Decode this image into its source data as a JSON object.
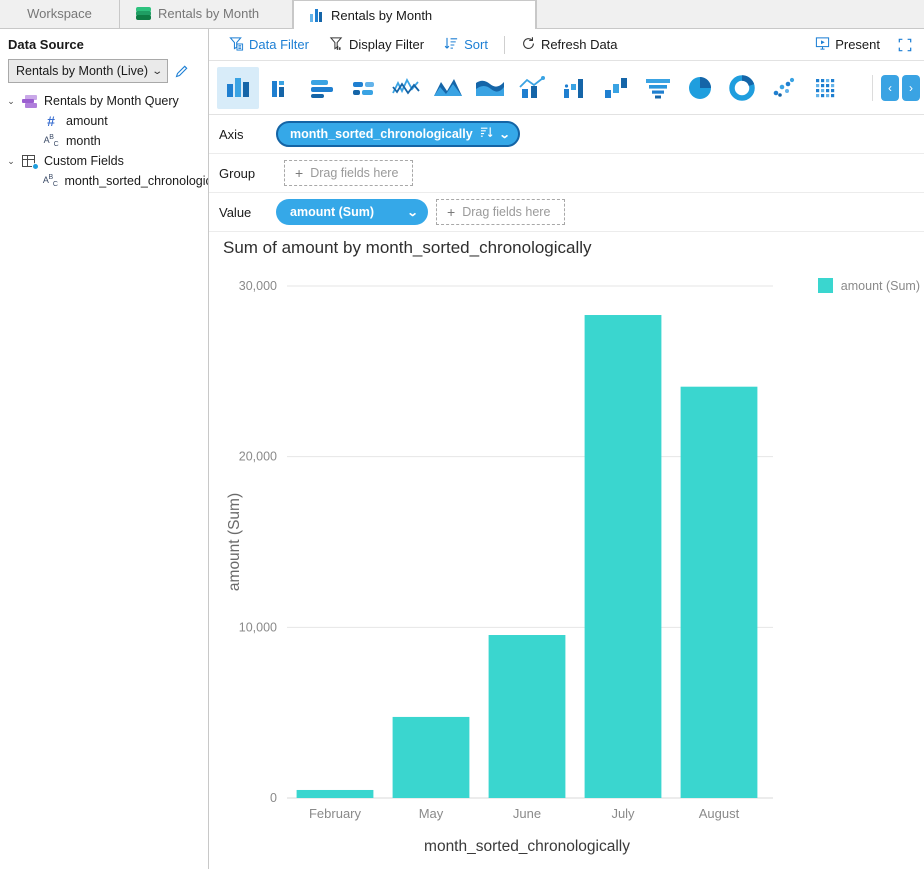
{
  "window": {
    "tabs": [
      {
        "label": "Workspace",
        "icon": "none",
        "active": false
      },
      {
        "label": "Rentals by Month",
        "icon": "green-stack-icon",
        "active": false
      },
      {
        "label": "Rentals by Month",
        "icon": "bar-chart-icon",
        "active": true
      }
    ]
  },
  "sidebar": {
    "title": "Data Source",
    "datasource": {
      "value": "Rentals by Month (Live)",
      "edit_icon": "pencil-icon",
      "caret": "⌄"
    },
    "tree": [
      {
        "label": "Rentals by Month Query",
        "icon": "query-icon",
        "level": 1,
        "expanded": true,
        "chevron": "⌄"
      },
      {
        "label": "amount",
        "icon": "number-field-icon",
        "level": 2,
        "type": "#"
      },
      {
        "label": "month",
        "icon": "text-field-icon",
        "level": 2,
        "type": "ABC"
      },
      {
        "label": "Custom Fields",
        "icon": "custom-fields-icon",
        "level": 1,
        "expanded": true,
        "chevron": "⌄"
      },
      {
        "label": "month_sorted_chronologica",
        "icon": "text-field-icon",
        "level": 2,
        "type": "ABC"
      }
    ]
  },
  "toolbar": {
    "items": [
      {
        "label": "Data Filter",
        "icon": "data-filter-icon",
        "style": "link"
      },
      {
        "label": "Display Filter",
        "icon": "display-filter-icon",
        "style": "dark"
      },
      {
        "label": "Sort",
        "icon": "sort-icon",
        "style": "link"
      },
      {
        "label": "Refresh Data",
        "icon": "refresh-icon",
        "style": "dark"
      }
    ],
    "present": {
      "label": "Present",
      "icon": "present-icon"
    },
    "fullscreen": {
      "icon": "fullscreen-icon"
    }
  },
  "chart_types": [
    {
      "name": "column-chart-icon",
      "selected": true
    },
    {
      "name": "column-chart-grouped-icon",
      "selected": false
    },
    {
      "name": "bar-chart-icon",
      "selected": false
    },
    {
      "name": "bar-chart-stacked-icon",
      "selected": false
    },
    {
      "name": "line-chart-icon",
      "selected": false
    },
    {
      "name": "area-chart-icon",
      "selected": false
    },
    {
      "name": "area-chart-smooth-icon",
      "selected": false
    },
    {
      "name": "combo-chart-icon",
      "selected": false
    },
    {
      "name": "combo-line-column-icon",
      "selected": false
    },
    {
      "name": "waterfall-chart-icon",
      "selected": false
    },
    {
      "name": "funnel-chart-icon",
      "selected": false
    },
    {
      "name": "pie-chart-icon",
      "selected": false
    },
    {
      "name": "donut-chart-icon",
      "selected": false
    },
    {
      "name": "scatter-chart-icon",
      "selected": false
    },
    {
      "name": "heatmap-chart-icon",
      "selected": false
    }
  ],
  "nav": {
    "prev": "‹",
    "next": "›"
  },
  "shelves": [
    {
      "label": "Axis",
      "pills": [
        {
          "text": "month_sorted_chronologically",
          "selected": true,
          "sort_icon": "sort-descending-icon",
          "caret": "⌄"
        }
      ],
      "dropzone": null
    },
    {
      "label": "Group",
      "pills": [],
      "dropzone": {
        "text": "Drag fields here",
        "plus": "+"
      }
    },
    {
      "label": "Value",
      "pills": [
        {
          "text": "amount (Sum)",
          "selected": false,
          "caret": "⌄"
        }
      ],
      "dropzone": {
        "text": "Drag fields here",
        "plus": "+"
      }
    }
  ],
  "colors": {
    "accent_blue": "#35a8e8",
    "pill_border": "#1464a5",
    "bar_teal": "#3ad6cf",
    "link_blue": "#1d7fd4",
    "grid_gray": "#e6e6e6",
    "axis_text": "#8a8a8a"
  },
  "chart_data": {
    "type": "bar",
    "title": "Sum of amount by month_sorted_chronologically",
    "xlabel": "month_sorted_chronologically",
    "ylabel": "amount (Sum)",
    "categories": [
      "February",
      "May",
      "June",
      "July",
      "August"
    ],
    "values": [
      470,
      4750,
      9550,
      28300,
      24100
    ],
    "series": [
      {
        "name": "amount (Sum)",
        "values": [
          470,
          4750,
          9550,
          28300,
          24100
        ]
      }
    ],
    "legend": [
      {
        "label": "amount (Sum)",
        "color": "#3ad6cf"
      }
    ],
    "legend_position": "right",
    "ylim": [
      0,
      30000
    ],
    "yticks": [
      0,
      10000,
      20000,
      30000
    ],
    "ytick_labels": [
      "0",
      "10,000",
      "20,000",
      "30,000"
    ],
    "grid": true
  }
}
